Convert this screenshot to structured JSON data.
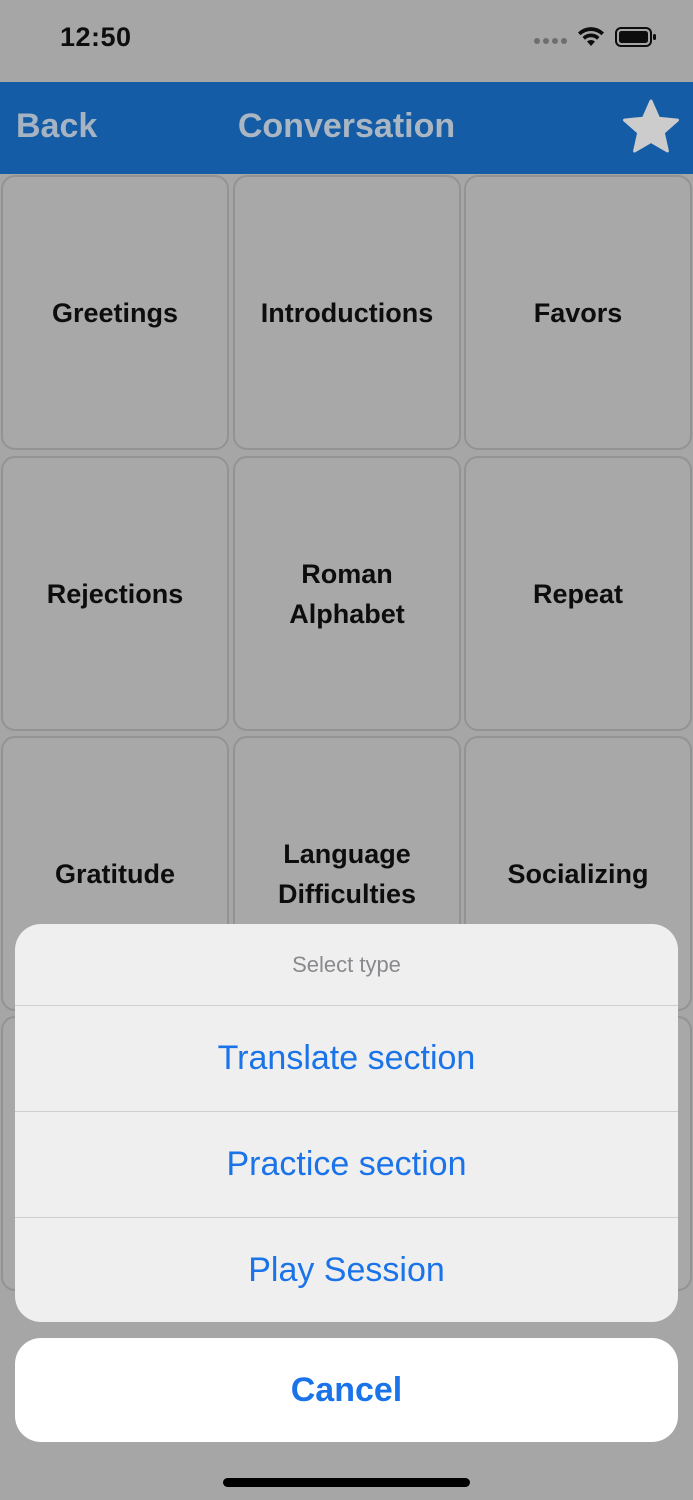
{
  "status_bar": {
    "time": "12:50"
  },
  "nav": {
    "back_label": "Back",
    "title": "Conversation",
    "favorite_icon": "star-icon"
  },
  "grid": {
    "tiles": [
      {
        "label": "Greetings"
      },
      {
        "label": "Introductions"
      },
      {
        "label": "Favors"
      },
      {
        "label": "Rejections"
      },
      {
        "label": "Roman Alphabet"
      },
      {
        "label": "Repeat"
      },
      {
        "label": "Gratitude"
      },
      {
        "label": "Language Difficulties"
      },
      {
        "label": "Socializing"
      }
    ]
  },
  "action_sheet": {
    "title": "Select type",
    "actions": [
      {
        "label": "Translate section"
      },
      {
        "label": "Practice section"
      },
      {
        "label": "Play Session"
      }
    ],
    "cancel_label": "Cancel"
  },
  "colors": {
    "nav_background": "#1a73cf",
    "action_text": "#1a73e8",
    "tile_background": "#d3d3d3"
  }
}
